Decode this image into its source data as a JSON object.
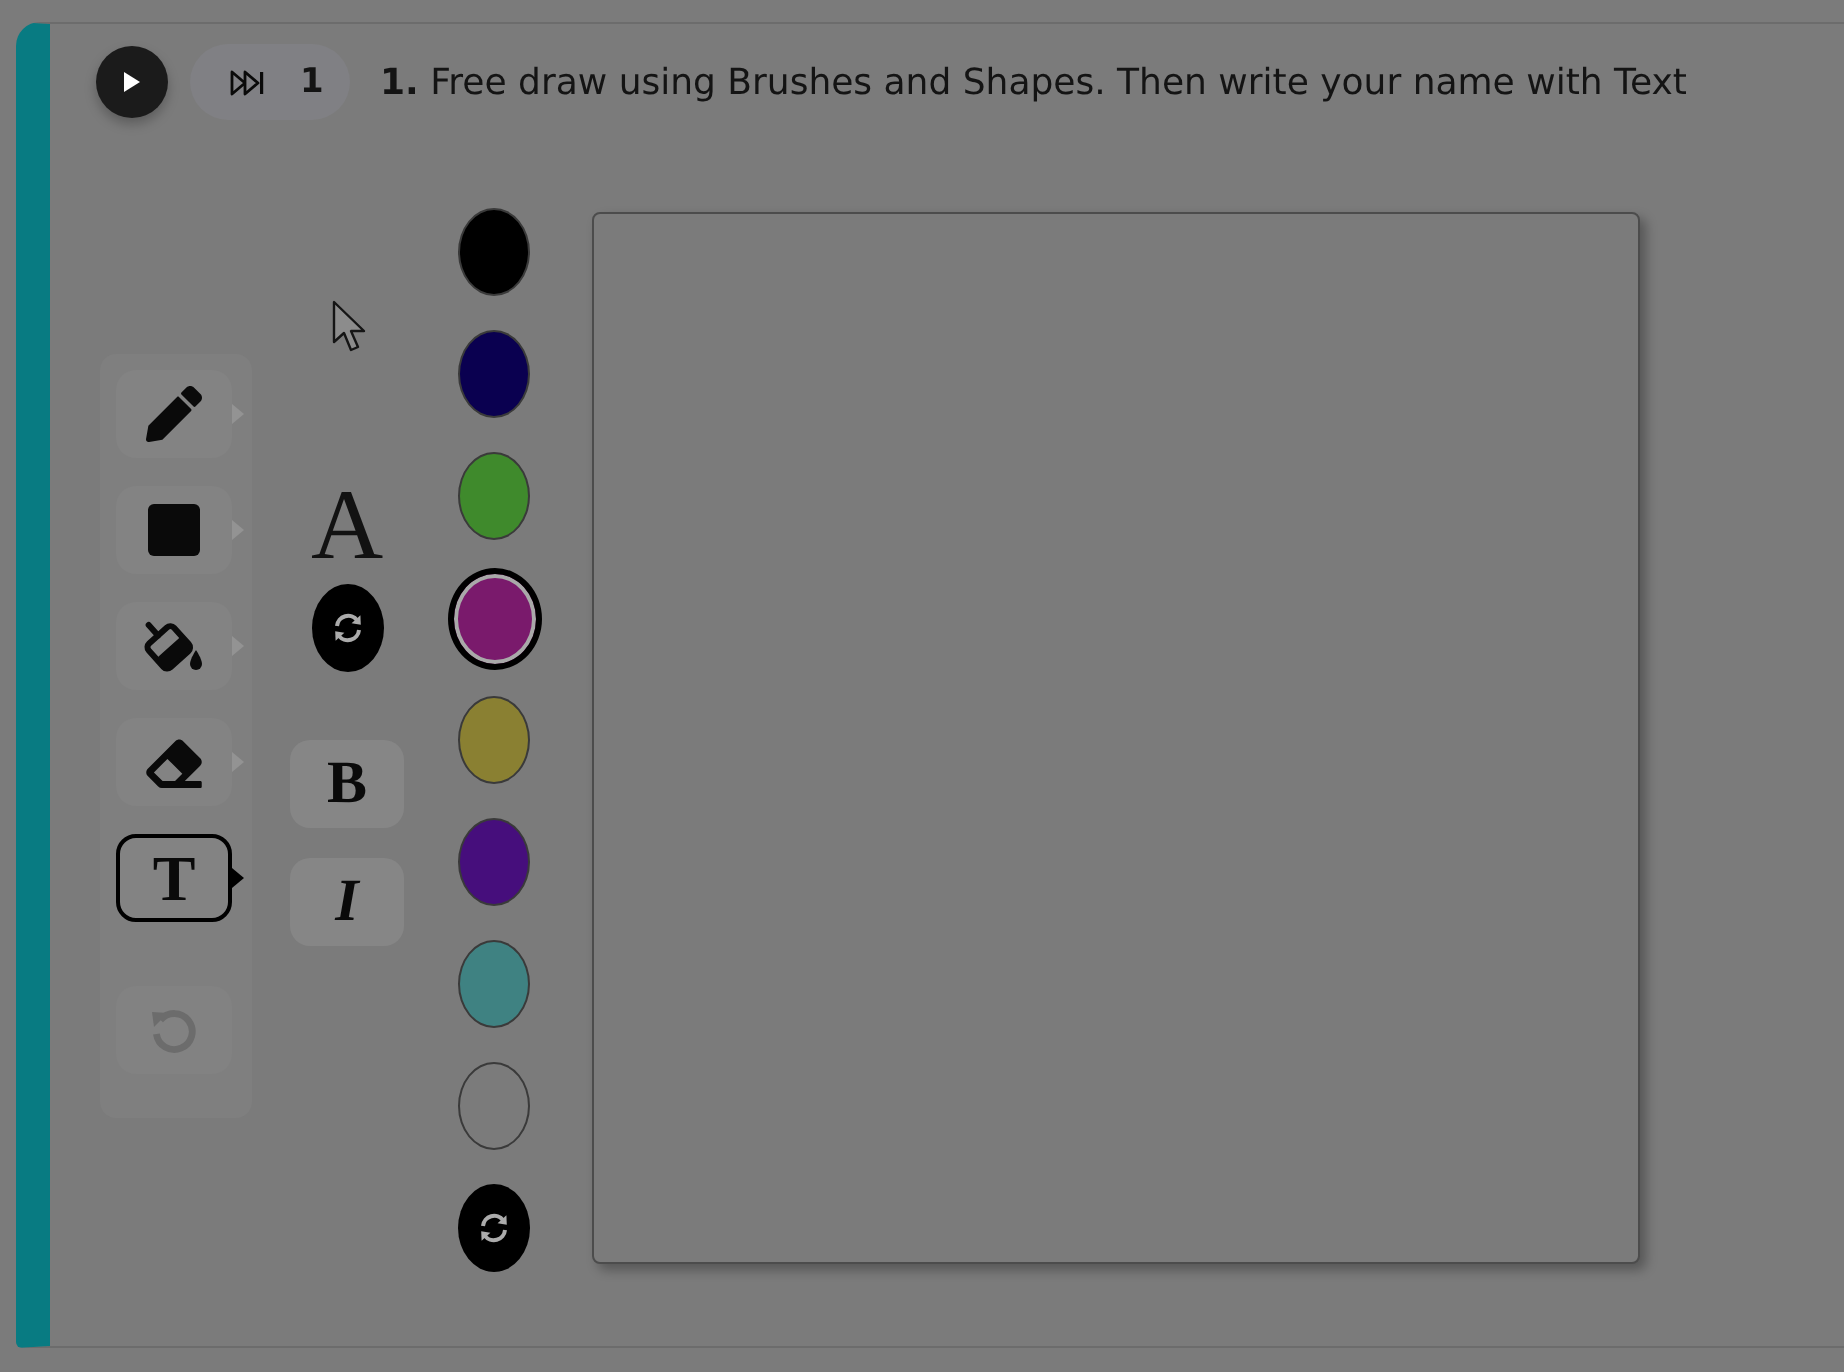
{
  "header": {
    "skip_count": "1",
    "question": "**1.** Free draw using Brushes and Shapes. Then write your name with Text"
  },
  "tools": [
    {
      "kind": "pencil",
      "selected": false
    },
    {
      "kind": "square",
      "selected": false
    },
    {
      "kind": "fill",
      "selected": false
    },
    {
      "kind": "eraser",
      "selected": false
    },
    {
      "kind": "text",
      "glyph": "T",
      "selected": true
    }
  ],
  "undo": {
    "disabled": true
  },
  "text_style": {
    "font_glyph": "A",
    "bold_label": "B",
    "italic_label": "I"
  },
  "colors": [
    {
      "color": "#000000",
      "selected": false
    },
    {
      "color": "#0a0050",
      "selected": false
    },
    {
      "color": "#3f8a2c",
      "selected": false
    },
    {
      "color": "#7a1a6c",
      "selected": true
    },
    {
      "color": "#8a8032",
      "selected": false
    },
    {
      "color": "#460e7c",
      "selected": false
    },
    {
      "color": "#3f8282",
      "selected": false
    },
    {
      "color": "#7b7b7b",
      "selected": false
    }
  ]
}
